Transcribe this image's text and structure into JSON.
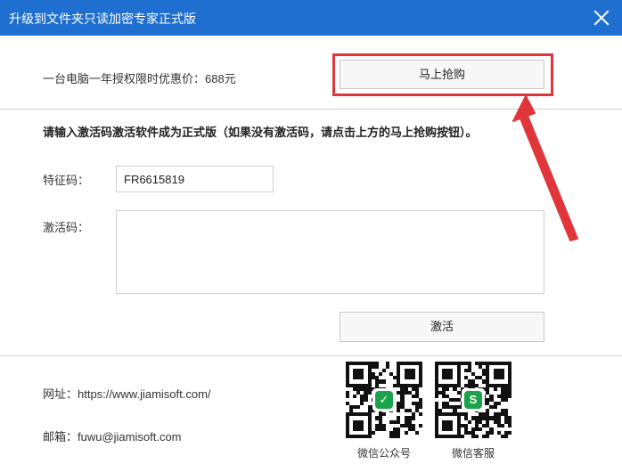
{
  "window": {
    "title": "升级到文件夹只读加密专家正式版",
    "close_icon": "close-icon"
  },
  "offer": {
    "price_text": "一台电脑一年授权限时优惠价：688元",
    "buy_button": "马上抢购",
    "highlight_color": "#e0363b"
  },
  "activation": {
    "instruction": "请输入激活码激活软件成为正式版（如果没有激活码，请点击上方的马上抢购按钮）。",
    "feature_code_label": "特征码：",
    "feature_code_value": "FR6615819",
    "activation_code_label": "激活码：",
    "activation_code_value": "",
    "activate_button": "激活"
  },
  "contact": {
    "website": "网址：https://www.jiamisoft.com/",
    "email": "邮箱：fuwu@jiamisoft.com"
  },
  "qr_codes": [
    {
      "caption": "微信公众号",
      "logo": "wechat-official-icon"
    },
    {
      "caption": "微信客服",
      "logo": "wechat-service-icon"
    }
  ],
  "colors": {
    "titlebar": "#1f6fd0",
    "accent_red": "#e0363b"
  }
}
